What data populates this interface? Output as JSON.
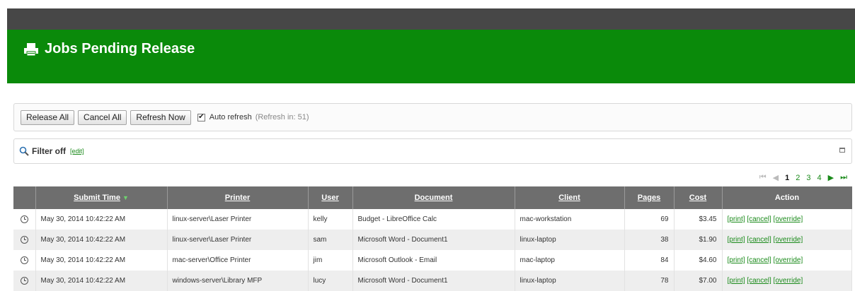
{
  "header": {
    "title": "Jobs Pending Release",
    "icon": "printer-icon"
  },
  "toolbar": {
    "release_all": "Release All",
    "cancel_all": "Cancel All",
    "refresh_now": "Refresh Now",
    "auto_refresh_checked": "✔",
    "auto_refresh_label": "Auto refresh",
    "refresh_countdown": "(Refresh in: 51)"
  },
  "filter": {
    "label": "Filter off",
    "edit": "[edit]"
  },
  "pager": {
    "first": "⏮",
    "prev": "◀",
    "pages": [
      "1",
      "2",
      "3",
      "4"
    ],
    "current": "1",
    "next": "▶",
    "last": "⏭"
  },
  "table": {
    "columns": [
      "",
      "Submit Time",
      "Printer",
      "User",
      "Document",
      "Client",
      "Pages",
      "Cost",
      "Action"
    ],
    "sort_indicator": "▼",
    "rows": [
      {
        "time": "May 30, 2014 10:42:22 AM",
        "printer": "linux-server\\Laser Printer",
        "user": "kelly",
        "document": "Budget - LibreOffice Calc",
        "client": "mac-workstation",
        "pages": "69",
        "cost": "$3.45"
      },
      {
        "time": "May 30, 2014 10:42:22 AM",
        "printer": "linux-server\\Laser Printer",
        "user": "sam",
        "document": "Microsoft Word - Document1",
        "client": "linux-laptop",
        "pages": "38",
        "cost": "$1.90"
      },
      {
        "time": "May 30, 2014 10:42:22 AM",
        "printer": "mac-server\\Office Printer",
        "user": "jim",
        "document": "Microsoft Outlook - Email",
        "client": "mac-laptop",
        "pages": "84",
        "cost": "$4.60"
      },
      {
        "time": "May 30, 2014 10:42:22 AM",
        "printer": "windows-server\\Library MFP",
        "user": "lucy",
        "document": "Microsoft Word - Document1",
        "client": "linux-laptop",
        "pages": "78",
        "cost": "$7.00"
      }
    ],
    "actions": {
      "print": "[print]",
      "cancel": "[cancel]",
      "override": "[override]"
    }
  },
  "colors": {
    "banner": "#0a8a0a",
    "topbar": "#474747",
    "link": "#1a8a1a",
    "header_row": "#6e6e6e"
  }
}
